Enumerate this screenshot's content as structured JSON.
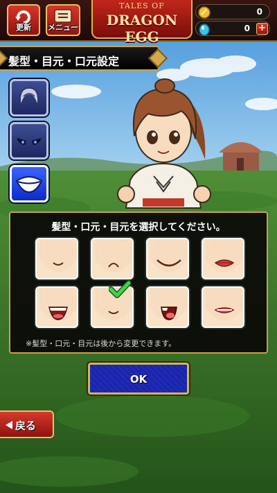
{
  "header": {
    "refresh_label": "更新",
    "menu_label": "メニュー",
    "logo_line1": "TALES OF",
    "logo_line2": "DRAGON EGG",
    "coin_count": "0",
    "gem_count": "0",
    "plus_label": "+"
  },
  "screen": {
    "title": "髪型・目元・口元設定"
  },
  "categories": [
    {
      "name": "hair",
      "icon": "hair-icon",
      "active": false
    },
    {
      "name": "eyes",
      "icon": "eyes-icon",
      "active": false
    },
    {
      "name": "mouth",
      "icon": "mouth-icon",
      "active": true
    }
  ],
  "panel": {
    "prompt": "髪型・口元・目元を選択してください。",
    "note": "※髪型・口元・目元は後から変更できます。",
    "selected_index": 5,
    "options": [
      {
        "icon": "mouth-smile-small-icon"
      },
      {
        "icon": "mouth-frown-icon"
      },
      {
        "icon": "mouth-wide-smile-icon"
      },
      {
        "icon": "mouth-lips-icon"
      },
      {
        "icon": "mouth-open-laugh-icon"
      },
      {
        "icon": "mouth-slight-smile-icon"
      },
      {
        "icon": "mouth-tongue-icon"
      },
      {
        "icon": "mouth-grimace-icon"
      }
    ]
  },
  "buttons": {
    "ok_label": "OK",
    "back_label": "戻る"
  },
  "colors": {
    "accent_gold": "#c9a04e",
    "button_red": "#c62a20",
    "button_blue": "#1e2ab8",
    "select_check": "#3fd24a"
  }
}
